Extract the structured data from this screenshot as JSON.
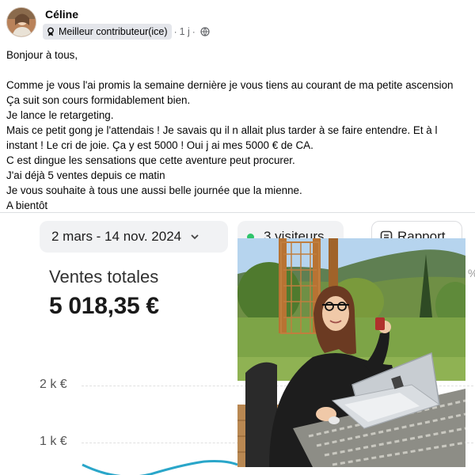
{
  "post": {
    "author": "Céline",
    "badge": "Meilleur contributeur(ice)",
    "separator": "·",
    "time": "1 j",
    "icons": {
      "badge": "contributor-badge-icon",
      "audience": "globe-icon"
    },
    "paragraphs": [
      "Bonjour à tous,",
      "",
      "Comme je vous l'ai promis la semaine dernière je vous tiens au courant de ma petite ascension",
      "Ça suit son cours formidablement bien.",
      "Je lance le retargeting.",
      "Mais ce petit gong je l'attendais ! Je savais qu il n allait plus tarder à se faire entendre. Et à l",
      "instant ! Le cri de joie. Ça y est 5000 ! Oui j ai mes 5000 € de CA.",
      "C est dingue les sensations que cette aventure peut procurer.",
      "J'ai déjà 5 ventes depuis ce matin",
      "Je vous souhaite à tous une aussi belle journée que la mienne.",
      "A bientôt"
    ]
  },
  "dashboard": {
    "date_range": "2 mars - 14 nov. 2024",
    "visitors": "3 visiteurs",
    "report": "Rapport",
    "total_label": "Ventes totales",
    "total_value": "5 018,35 €",
    "edge_text": "%",
    "colors": {
      "live_dot": "#2fc46b",
      "line": "#2aa6c9"
    }
  },
  "chart_data": {
    "type": "line",
    "y_ticks": [
      "2 k €",
      "1 k €"
    ],
    "series_visible": "partial"
  }
}
